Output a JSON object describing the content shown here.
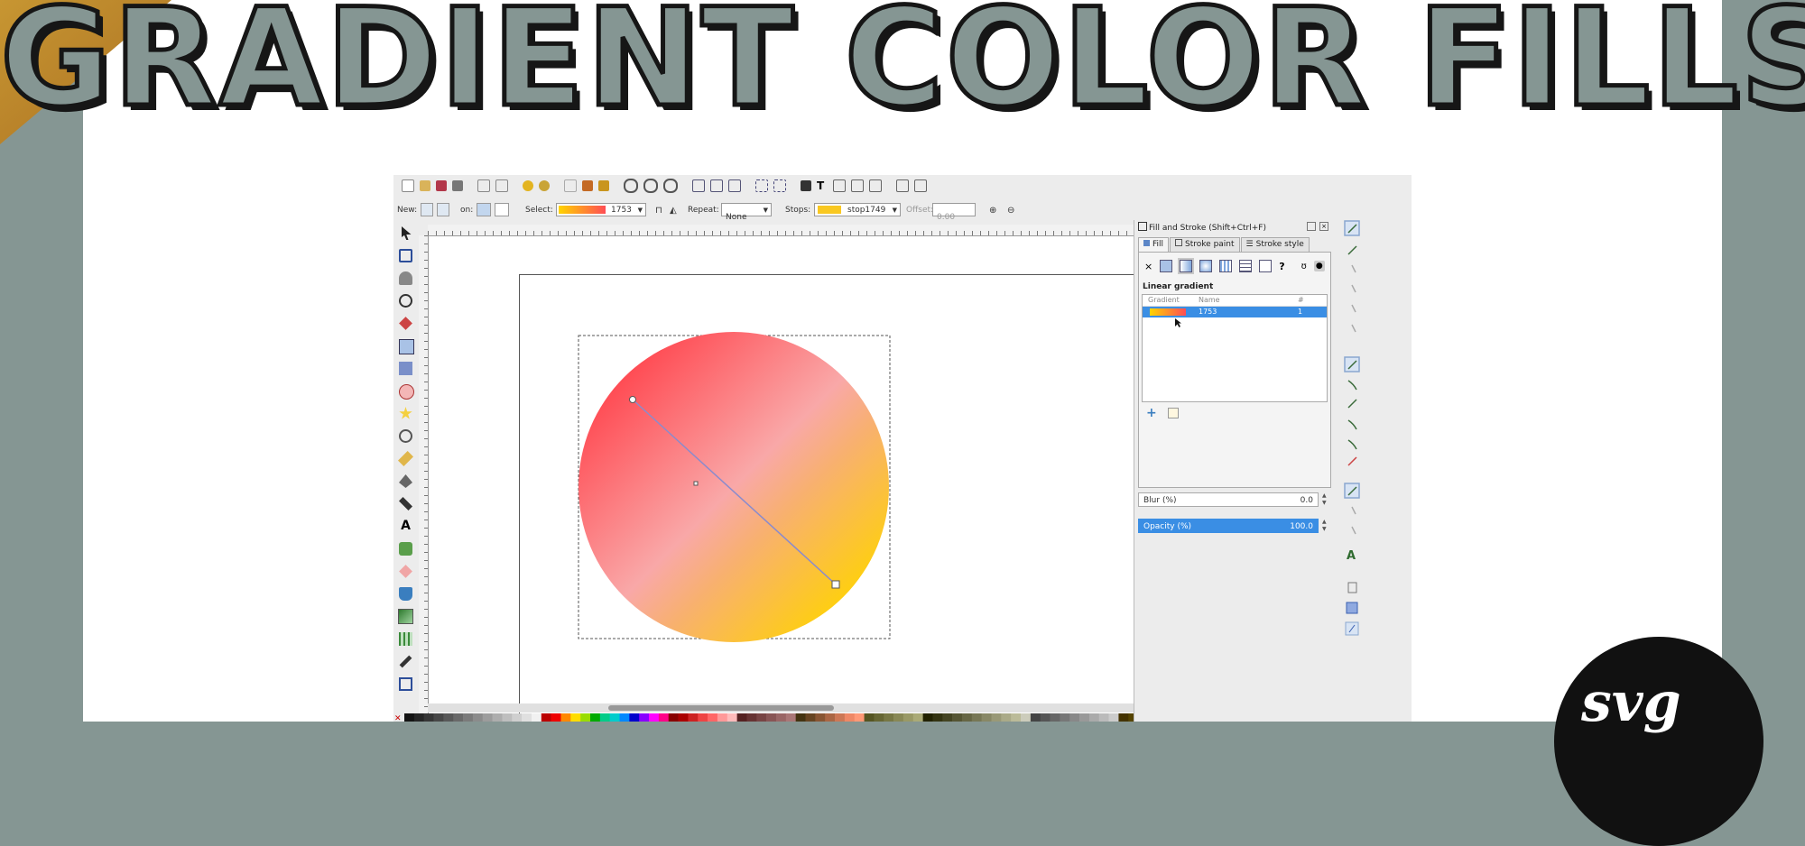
{
  "title": "GRADIENT COLOR FILLS",
  "colors": {
    "background": "#859693",
    "white_panel": "#ffffff",
    "accent_selection": "#3a8ee4",
    "gradient_start": "#ff4d55",
    "gradient_mid": "#f9a8a8",
    "gradient_end": "#ffd400",
    "logo": "#111111"
  },
  "toolbar": {
    "new_label": "New:",
    "on_label": "on:",
    "select_label": "Select:",
    "select_value": "1753",
    "repeat_label": "Repeat:",
    "repeat_value": "None",
    "stops_label": "Stops:",
    "stops_value": "stop1749",
    "offset_label": "Offset:",
    "offset_value": "0.00"
  },
  "fill_stroke": {
    "dialog_title": "Fill and Stroke (Shift+Ctrl+F)",
    "tabs": [
      {
        "label": "Fill",
        "icon": "fill-tab-icon"
      },
      {
        "label": "Stroke paint",
        "icon": "stroke-paint-tab-icon"
      },
      {
        "label": "Stroke style",
        "icon": "stroke-style-tab-icon"
      }
    ],
    "gradient_type": "Linear gradient",
    "table_headers": {
      "gradient": "Gradient",
      "name": "Name",
      "count": "#"
    },
    "rows": [
      {
        "name": "1753",
        "count": "1"
      }
    ],
    "blur_label": "Blur (%)",
    "blur_value": "0.0",
    "opacity_label": "Opacity (%)",
    "opacity_value": "100.0"
  },
  "logo_text": "svg"
}
